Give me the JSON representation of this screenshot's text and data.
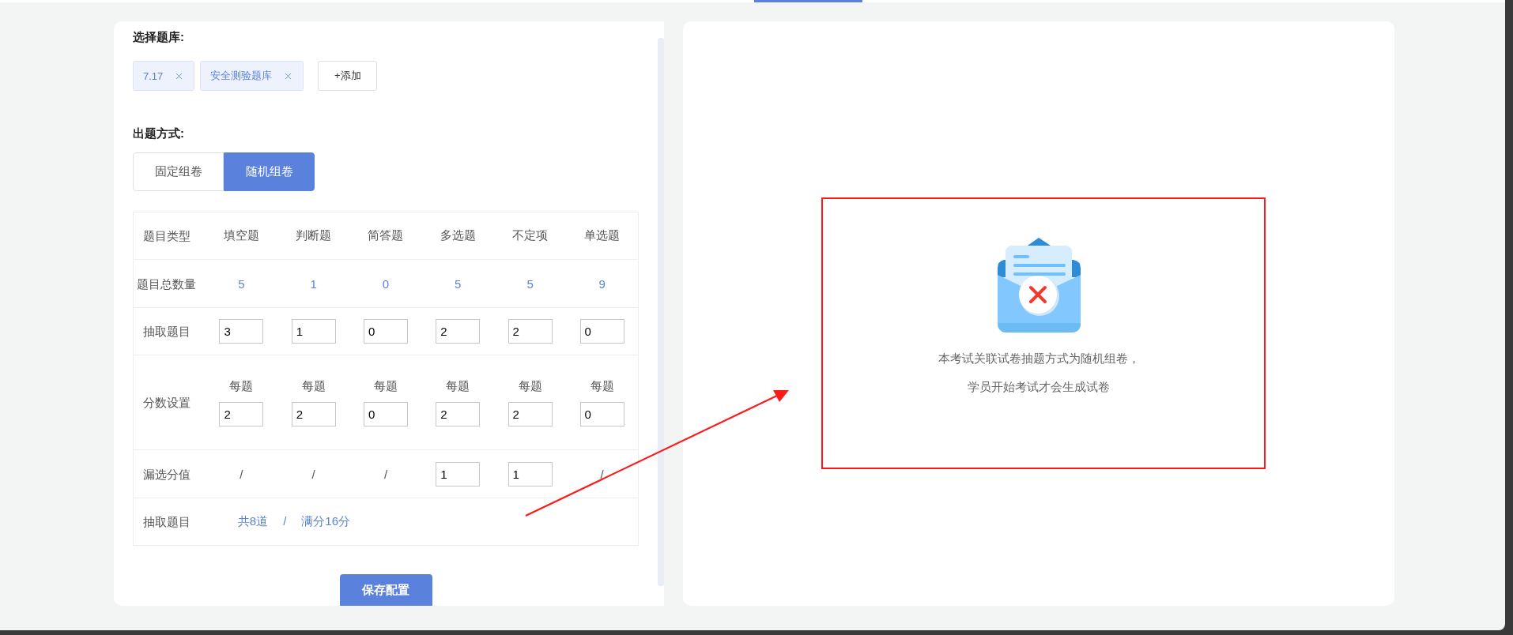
{
  "question_bank": {
    "label": "选择题库:",
    "tags": [
      {
        "label": "7.17"
      },
      {
        "label": "安全测验题库"
      }
    ],
    "add_button": "+添加"
  },
  "mode": {
    "label": "出题方式:",
    "options": [
      {
        "label": "固定组卷",
        "selected": false
      },
      {
        "label": "随机组卷",
        "selected": true
      }
    ]
  },
  "table": {
    "columns": [
      "题目类型",
      "填空题",
      "判断题",
      "简答题",
      "多选题",
      "不定项",
      "单选题"
    ],
    "rows": [
      {
        "kind": "count",
        "label": "题目总数量",
        "cells": [
          "5",
          "1",
          "0",
          "5",
          "5",
          "9"
        ]
      },
      {
        "kind": "input",
        "label": "抽取题目",
        "cells": [
          "3",
          "1",
          "0",
          "2",
          "2",
          "0"
        ]
      },
      {
        "kind": "score",
        "label": "分数设置",
        "cells": [
          {
            "caption": "每题",
            "value": "2"
          },
          {
            "caption": "每题",
            "value": "2"
          },
          {
            "caption": "每题",
            "value": "0"
          },
          {
            "caption": "每题",
            "value": "2"
          },
          {
            "caption": "每题",
            "value": "2"
          },
          {
            "caption": "每题",
            "value": "0"
          }
        ]
      },
      {
        "kind": "mixed",
        "label": "漏选分值",
        "cells": [
          {
            "kind": "text",
            "text": "/"
          },
          {
            "kind": "text",
            "text": "/"
          },
          {
            "kind": "text",
            "text": "/"
          },
          {
            "kind": "input",
            "value": "1"
          },
          {
            "kind": "input",
            "value": "1"
          },
          {
            "kind": "text",
            "text": "/"
          }
        ]
      },
      {
        "kind": "summary",
        "label": "抽取题目",
        "total": "共8道",
        "separator": "/",
        "full_score": "满分16分"
      }
    ]
  },
  "save_button": "保存配置",
  "notice": {
    "lines": [
      "本考试关联试卷抽题方式为随机组卷，",
      "学员开始考试才会生成试卷"
    ]
  }
}
